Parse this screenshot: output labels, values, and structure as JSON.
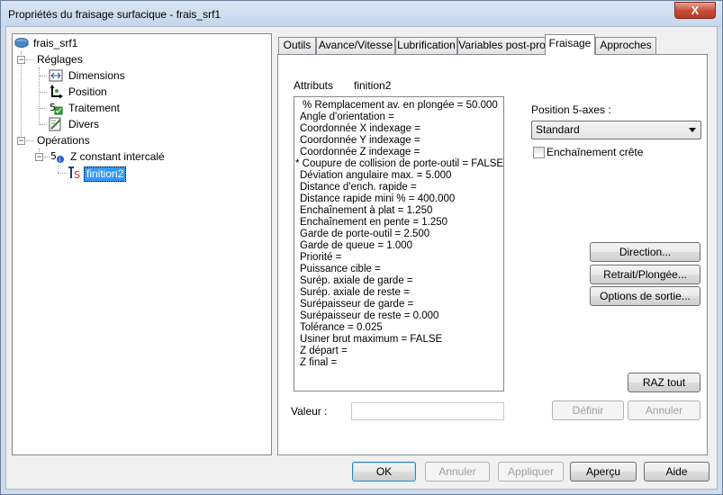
{
  "window": {
    "title": "Propriétés du fraisage surfacique - frais_srf1",
    "close_label": "X"
  },
  "tree": {
    "root": "frais_srf1",
    "settings": "Réglages",
    "settings_items": [
      "Dimensions",
      "Position",
      "Traitement",
      "Divers"
    ],
    "operations": "Opérations",
    "operation": "Z constant intercalé",
    "selected": "finition2"
  },
  "tabs": [
    "Outils",
    "Avance/Vitesse",
    "Lubrification",
    "Variables post-pro",
    "Fraisage",
    "Approches"
  ],
  "active_tab": "Fraisage",
  "attributes": {
    "header_label": "Attributs",
    "header_value": "finition2",
    "items": [
      "% Remplacement av. en plongée = 50.000",
      "Angle d'orientation =",
      "Coordonnée X indexage =",
      "Coordonnée Y indexage =",
      "Coordonnée Z indexage =",
      "* Coupure de collision de porte-outil = FALSE",
      "Déviation angulaire max. = 5.000",
      "Distance d'ench. rapide =",
      "Distance rapide mini % = 400.000",
      "Enchaînement à plat = 1.250",
      "Enchaînement en pente = 1.250",
      "Garde de porte-outil = 2.500",
      "Garde de queue = 1.000",
      "Priorité =",
      "Puissance cible =",
      "Surép. axiale de garde =",
      "Surép. axiale de reste =",
      "Surépaisseur de garde =",
      "Surépaisseur de reste = 0.000",
      "Tolérance = 0.025",
      "Usiner brut maximum = FALSE",
      "Z départ =",
      "Z final ="
    ]
  },
  "value_label": "Valeur :",
  "value_input": "",
  "position5": {
    "label": "Position 5-axes :",
    "selected": "Standard"
  },
  "ridge_checkbox": {
    "label": "Enchaînement crête",
    "checked": false
  },
  "buttons": {
    "direction": "Direction...",
    "retract": "Retrait/Plongée...",
    "output": "Options de sortie...",
    "reset": "RAZ tout",
    "define": "Définir",
    "cancel_attr": "Annuler"
  },
  "footer": {
    "ok": "OK",
    "cancel": "Annuler",
    "apply": "Appliquer",
    "preview": "Aperçu",
    "help": "Aide"
  }
}
